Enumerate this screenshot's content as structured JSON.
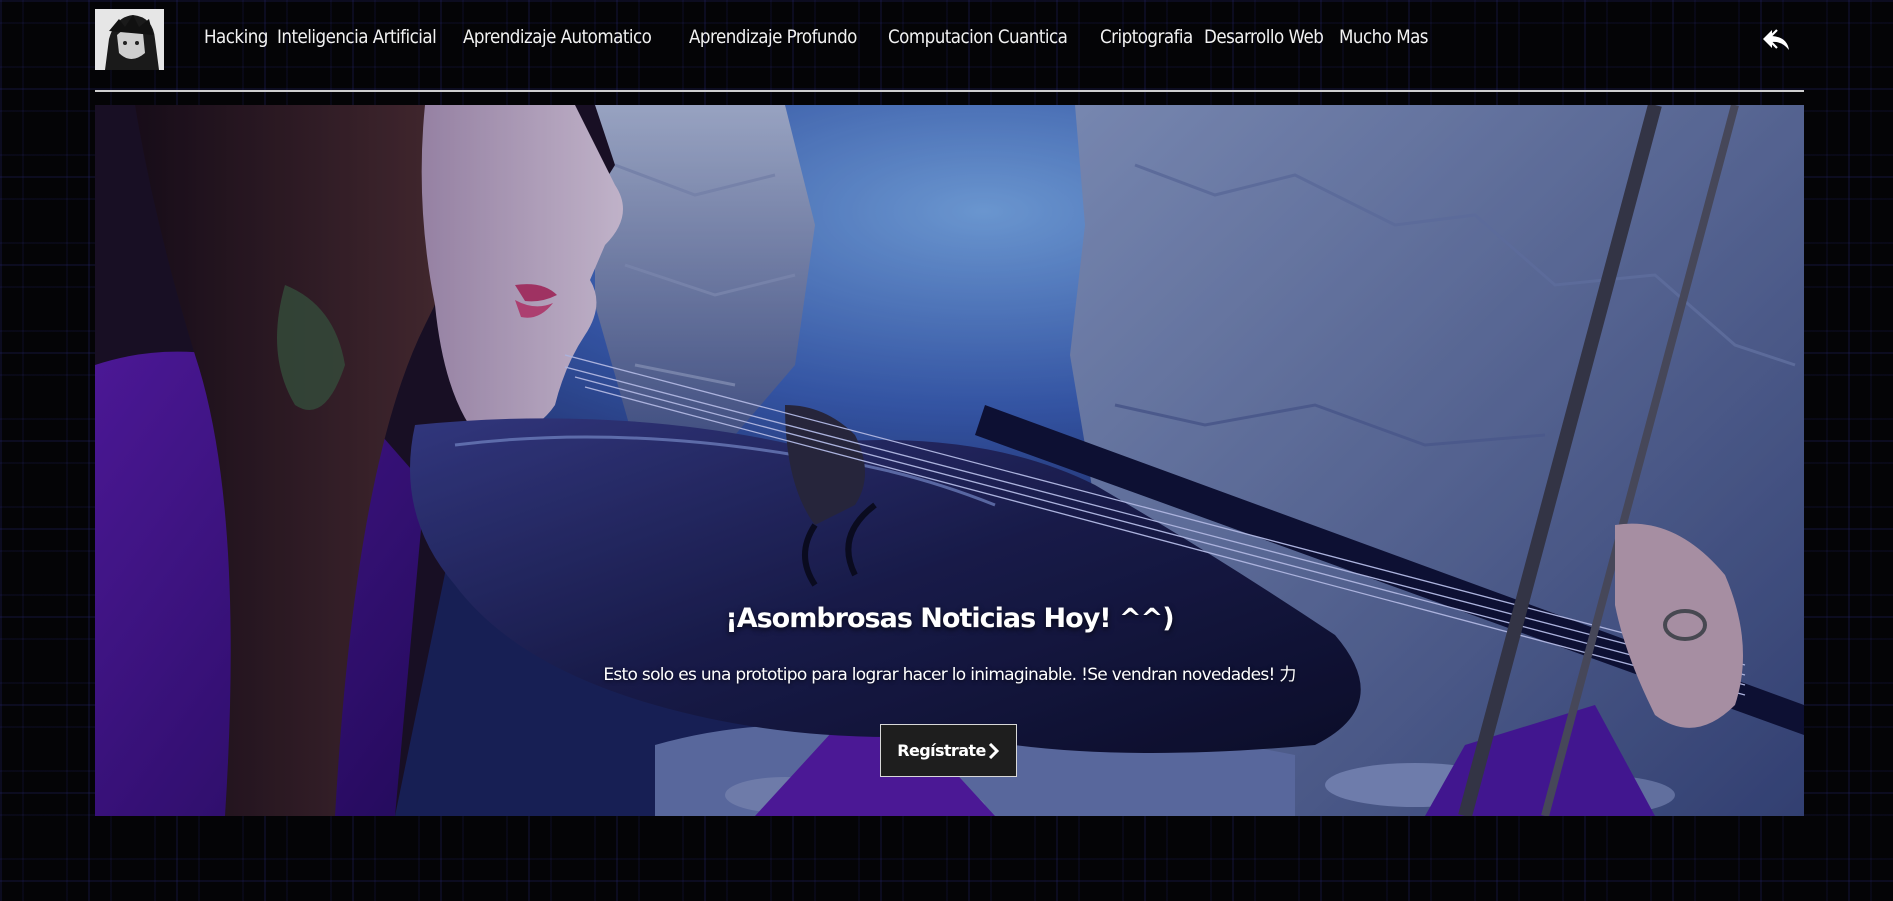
{
  "header": {
    "logo_alt": "avatar",
    "nav": [
      {
        "label": "Hacking"
      },
      {
        "label": "Inteligencia Artificial"
      },
      {
        "label": "Aprendizaje Automatico"
      },
      {
        "label": "Aprendizaje Profundo"
      },
      {
        "label": "Computacion Cuantica"
      },
      {
        "label": "Criptografia"
      },
      {
        "label": "Desarrollo Web"
      },
      {
        "label": "Mucho Mas"
      }
    ],
    "back_icon": "reply-icon"
  },
  "hero": {
    "title": "¡Asombrosas Noticias Hoy! ^^)",
    "subtitle": "Esto solo es una prototipo para lograr hacer lo inimaginable. !Se vendran novedades! 力",
    "cta_label": "Regístrate",
    "cta_icon": "chevron-right-icon"
  },
  "colors": {
    "background": "#040406",
    "pattern": "#1a1a55",
    "nav_text": "#f2f2f2",
    "divider": "#cfcfcf",
    "cta_bg": "#1e1e1e"
  }
}
